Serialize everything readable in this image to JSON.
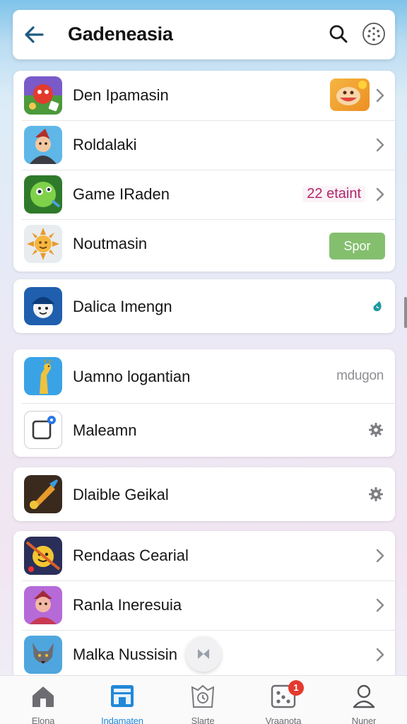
{
  "header": {
    "title": "Gadeneasia",
    "back_icon": "arrow-left-icon",
    "search_icon": "search-icon",
    "menu_icon": "dots-circle-icon"
  },
  "groups": [
    {
      "rows": [
        {
          "label": "Den Ipamasin",
          "icon": "red-creature-app-icon",
          "trailing": "app-badge-icon"
        },
        {
          "label": "Roldalakі",
          "icon": "character-app-icon",
          "trailing": "chevron"
        },
        {
          "label": "Game IRaden",
          "icon": "green-creature-app-icon",
          "trailing_text": "22 etaint"
        },
        {
          "label": "Noutmasin",
          "icon": "sun-app-icon",
          "button": "Spor"
        }
      ]
    },
    {
      "rows": [
        {
          "label": "Dalica Imengn",
          "icon": "helmet-app-icon",
          "trailing": "teal-drop-icon"
        }
      ]
    },
    {
      "rows": [
        {
          "label": "Uamno logantian",
          "icon": "giraffe-app-icon",
          "trailing_text": "mdugon"
        },
        {
          "label": "Maleamn",
          "icon": "frame-app-icon",
          "trailing": "gear-icon"
        }
      ]
    },
    {
      "rows": [
        {
          "label": "Dlaible Geikal",
          "icon": "brush-app-icon",
          "trailing": "gear-icon"
        }
      ]
    },
    {
      "rows": [
        {
          "label": "Rendaas Cearial",
          "icon": "yellow-face-app-icon",
          "trailing": "chevron"
        },
        {
          "label": "Ranla Ineresuia",
          "icon": "pink-character-app-icon",
          "trailing": "chevron"
        },
        {
          "label": "Malka Nussisin",
          "icon": "wolf-app-icon",
          "trailing": "chevron"
        }
      ]
    }
  ],
  "tabs": [
    {
      "label": "Elona",
      "icon": "home-icon",
      "active": false
    },
    {
      "label": "Indamaten",
      "icon": "store-icon",
      "active": true
    },
    {
      "label": "Slarte",
      "icon": "clock-bag-icon",
      "active": false
    },
    {
      "label": "Vraanota",
      "icon": "dice-icon",
      "active": false,
      "badge": "1"
    },
    {
      "label": "Nuner",
      "icon": "user-icon",
      "active": false
    }
  ],
  "colors": {
    "accent": "#2188d8",
    "badge_red": "#e43a2f",
    "spor_green": "#84bf6e",
    "count_magenta": "#b1266b"
  }
}
